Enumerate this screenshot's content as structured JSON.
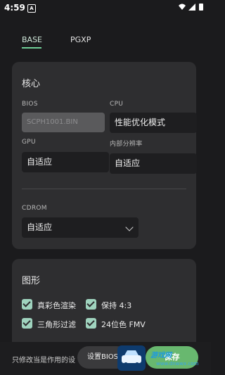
{
  "status_bar": {
    "time": "4:59",
    "notification_letter": "A"
  },
  "tabs": [
    {
      "label": "BASE",
      "active": true
    },
    {
      "label": "PGXP",
      "active": false
    }
  ],
  "colors": {
    "accent": "#6fcf97",
    "checkbox": "#9fd3be",
    "save_button": "#68b86f",
    "card": "#2e2e30"
  },
  "core": {
    "title": "核心",
    "bios_label": "BIOS",
    "bios_value": "SCPH1001.BIN",
    "cpu_label": "CPU",
    "cpu_value": "性能优化模式",
    "gpu_label": "GPU",
    "gpu_value": "自适应",
    "internal_res_label": "内部分辨率",
    "internal_res_value": "自适应",
    "cdrom_label": "CDROM",
    "cdrom_value": "自适应"
  },
  "graphics": {
    "title": "图形",
    "options": [
      {
        "label": "真彩色渲染",
        "checked": true
      },
      {
        "label": "保持 4:3",
        "checked": true
      },
      {
        "label": "三角形过滤",
        "checked": true
      },
      {
        "label": "24位色 FMV",
        "checked": true
      }
    ]
  },
  "bottom": {
    "hint": "只修改当是作用的设",
    "set_bios_label": "设置BIOS",
    "save_label": "保存"
  },
  "watermark": {
    "text": "游戏网",
    "url": "www.dnwwx.com"
  }
}
